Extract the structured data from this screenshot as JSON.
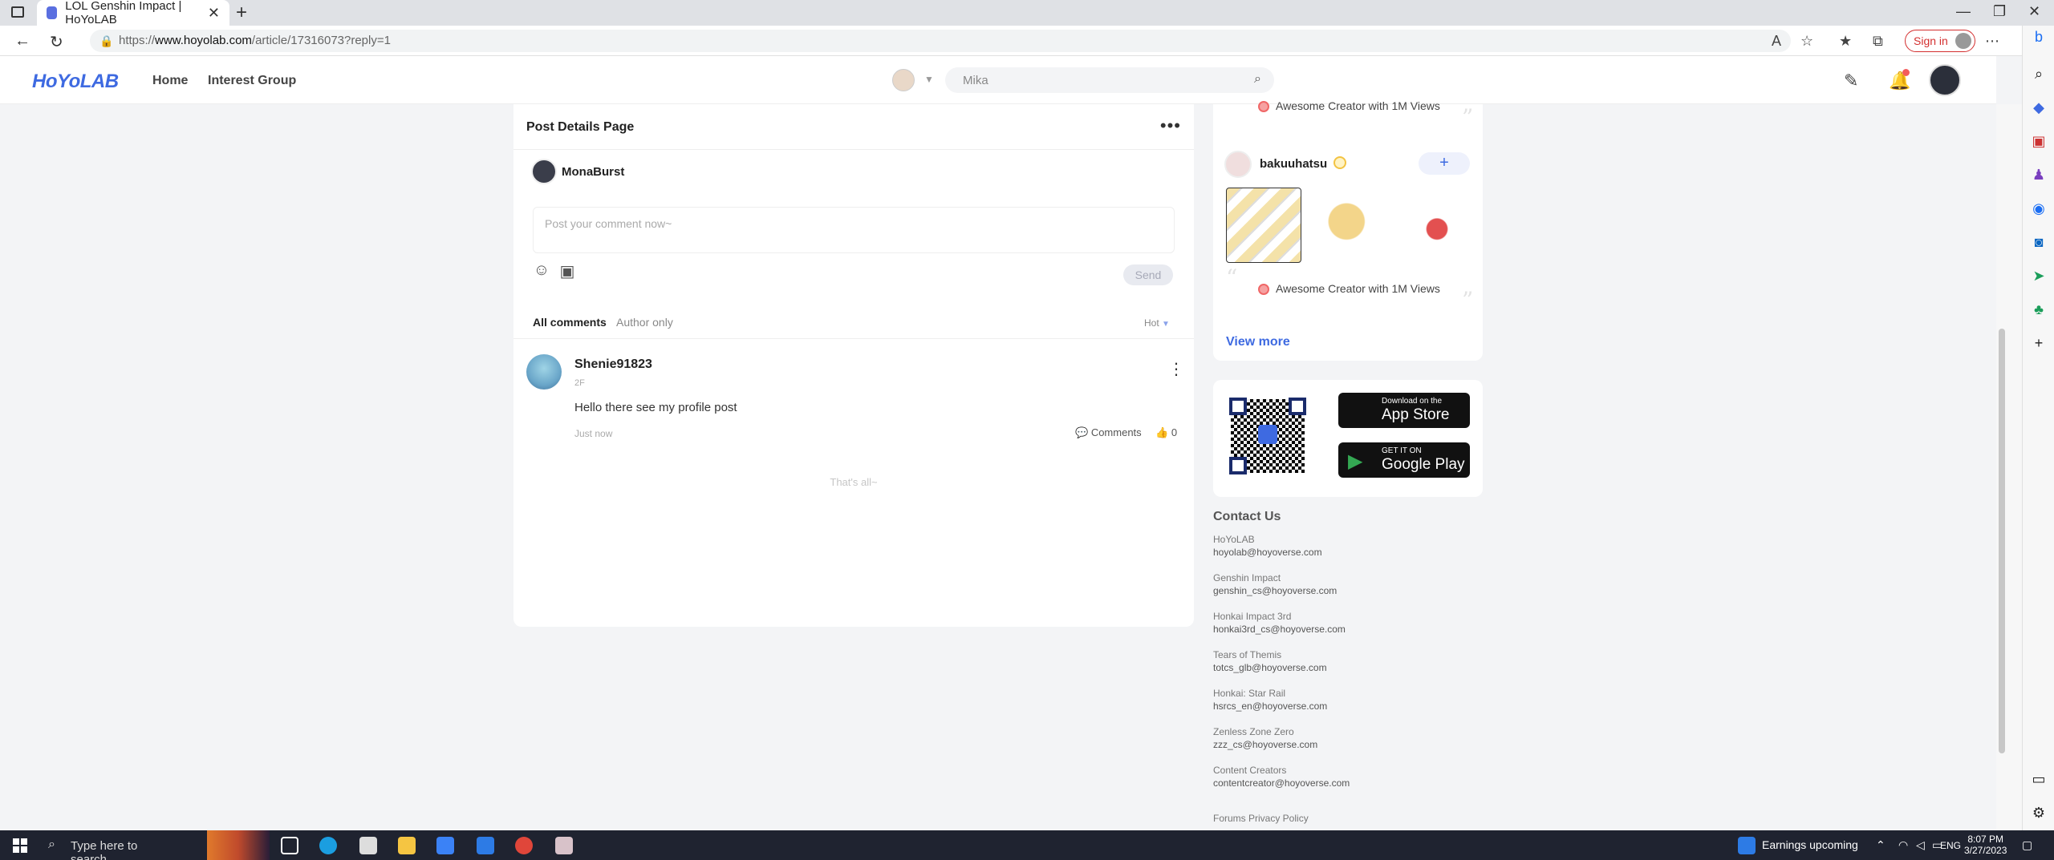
{
  "browser": {
    "tab_title": "LOL Genshin Impact | HoYoLAB",
    "url_prefix": "https://",
    "url_domain": "www.hoyolab.com",
    "url_path": "/article/17316073?reply=1",
    "sign_in": "Sign in"
  },
  "header": {
    "logo": "HoYoLAB",
    "nav": [
      "Home",
      "Interest Group"
    ],
    "search_placeholder": "Mika"
  },
  "post": {
    "title": "Post Details Page",
    "author": "MonaBurst",
    "comment_placeholder": "Post your comment now~",
    "send": "Send",
    "tabs": [
      "All comments",
      "Author only"
    ],
    "sort": "Hot",
    "comment": {
      "user": "Shenie91823",
      "floor": "2F",
      "text": "Hello there see my profile post",
      "time": "Just now",
      "comments_label": "Comments",
      "likes": "0"
    },
    "end_note": "That's all~"
  },
  "sidebar": {
    "badge_top": "Awesome Creator with 1M Views",
    "creator": {
      "name": "bakuuhatsu",
      "badge": "Awesome Creator with 1M Views"
    },
    "view_more": "View more",
    "app_store": {
      "small": "Download on the",
      "big": "App Store"
    },
    "google_play": {
      "small": "GET IT ON",
      "big": "Google Play"
    }
  },
  "contact": {
    "title": "Contact Us",
    "items": [
      {
        "label": "HoYoLAB",
        "email": "hoyolab@hoyoverse.com"
      },
      {
        "label": "Genshin Impact",
        "email": "genshin_cs@hoyoverse.com"
      },
      {
        "label": "Honkai Impact 3rd",
        "email": "honkai3rd_cs@hoyoverse.com"
      },
      {
        "label": "Tears of Themis",
        "email": "totcs_glb@hoyoverse.com"
      },
      {
        "label": "Honkai: Star Rail",
        "email": "hsrcs_en@hoyoverse.com"
      },
      {
        "label": "Zenless Zone Zero",
        "email": "zzz_cs@hoyoverse.com"
      },
      {
        "label": "Content Creators",
        "email": "contentcreator@hoyoverse.com"
      }
    ],
    "footer_link": "Forums Privacy Policy"
  },
  "taskbar": {
    "search_placeholder": "Type here to search",
    "news": "Earnings upcoming",
    "lang": "ENG",
    "time": "8:07 PM",
    "date": "3/27/2023"
  },
  "colors": {
    "brand": "#3e6ae1",
    "signin": "#d32f2f",
    "taskbar": "#1f2330"
  }
}
